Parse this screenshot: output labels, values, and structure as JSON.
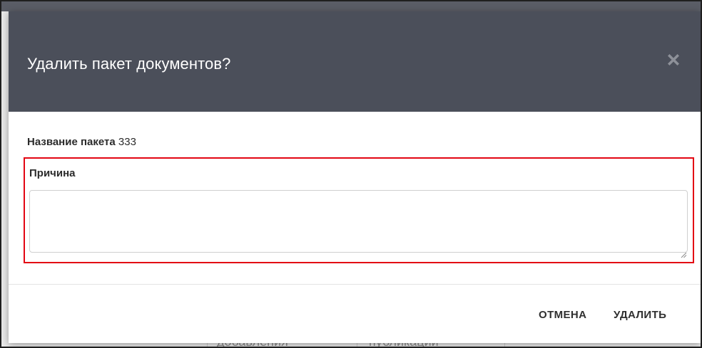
{
  "background": {
    "column_1_text": "добавления",
    "column_2_text": "публикации"
  },
  "dialog": {
    "title": "Удалить пакет документов?",
    "close_icon": "close-x-icon",
    "package_name_label": "Название пакета",
    "package_name_value": "333",
    "reason_label": "Причина",
    "reason_value": "",
    "reason_placeholder": "",
    "cancel_label": "ОТМЕНА",
    "delete_label": "УДАЛИТЬ"
  },
  "colors": {
    "header_bg": "#4b4f5a",
    "highlight_border": "#e30613",
    "button_text": "#2f2f2f"
  }
}
